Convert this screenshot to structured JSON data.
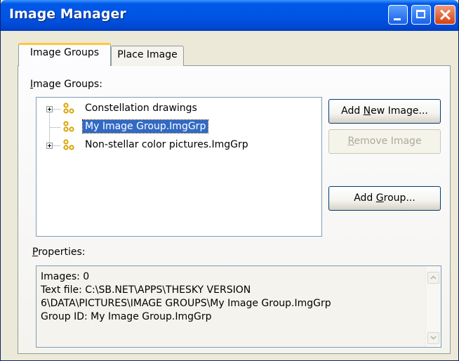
{
  "window": {
    "title": "Image Manager"
  },
  "tabs": [
    {
      "label": "Image Groups",
      "active": true
    },
    {
      "label": "Place Image",
      "active": false
    }
  ],
  "groups_section": {
    "label_first": "I",
    "label_rest": "mage Groups:"
  },
  "tree": {
    "items": [
      {
        "label": "Constellation drawings",
        "expandable": true,
        "selected": false
      },
      {
        "label": "My Image Group.ImgGrp",
        "expandable": false,
        "selected": true
      },
      {
        "label": "Non-stellar color pictures.ImgGrp",
        "expandable": true,
        "selected": false
      }
    ]
  },
  "buttons": {
    "add_new_image": {
      "pre": "Add ",
      "accel": "N",
      "post": "ew Image...",
      "enabled": true
    },
    "remove_image": {
      "pre": "",
      "accel": "R",
      "post": "emove Image",
      "enabled": false
    },
    "add_group": {
      "pre": "Add ",
      "accel": "G",
      "post": "roup...",
      "enabled": true
    }
  },
  "properties": {
    "label_first": "P",
    "label_rest": "roperties:",
    "lines": [
      "Images: 0",
      "Text file: C:\\SB.NET\\APPS\\THESKY VERSION",
      "6\\DATA\\PICTURES\\IMAGE GROUPS\\My Image Group.ImgGrp",
      "Group ID: My Image Group.ImgGrp"
    ]
  },
  "icons": {
    "group": "group-icon",
    "expand": "plus-expander-icon",
    "minimize": "minimize-icon",
    "maximize": "maximize-icon",
    "close": "close-icon"
  },
  "colors": {
    "titlebar": "#0055e5",
    "selection": "#316ac5",
    "group_icon": "#d9a400",
    "active_tab_highlight": "#ffc83c"
  }
}
